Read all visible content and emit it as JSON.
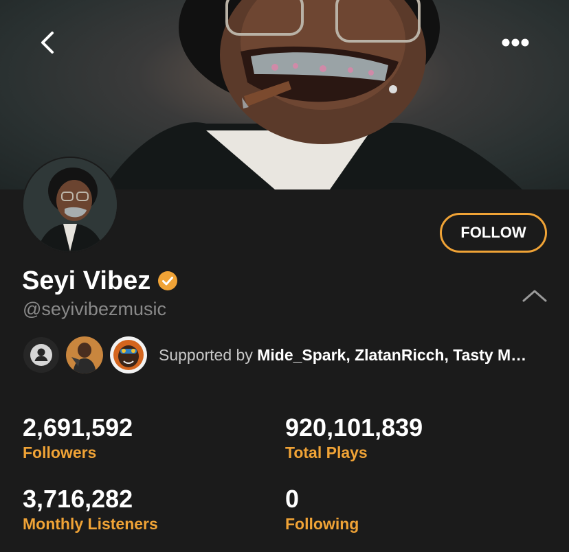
{
  "header": {
    "back_icon": "chevron-left-icon",
    "more_icon": "more-horizontal-icon"
  },
  "profile": {
    "name": "Seyi Vibez",
    "verified": true,
    "handle": "@seyivibezmusic",
    "follow_label": "FOLLOW"
  },
  "support": {
    "prefix": "Supported by ",
    "names": "Mide_Spark, ZlatanRicch, Tasty M…"
  },
  "stats": [
    {
      "value": "2,691,592",
      "label": "Followers"
    },
    {
      "value": "920,101,839",
      "label": "Total Plays"
    },
    {
      "value": "3,716,282",
      "label": "Monthly Listeners"
    },
    {
      "value": "0",
      "label": "Following"
    }
  ],
  "colors": {
    "accent": "#f0a336",
    "background": "#1b1b1b",
    "text": "#ffffff",
    "muted": "#8a8a8a"
  }
}
